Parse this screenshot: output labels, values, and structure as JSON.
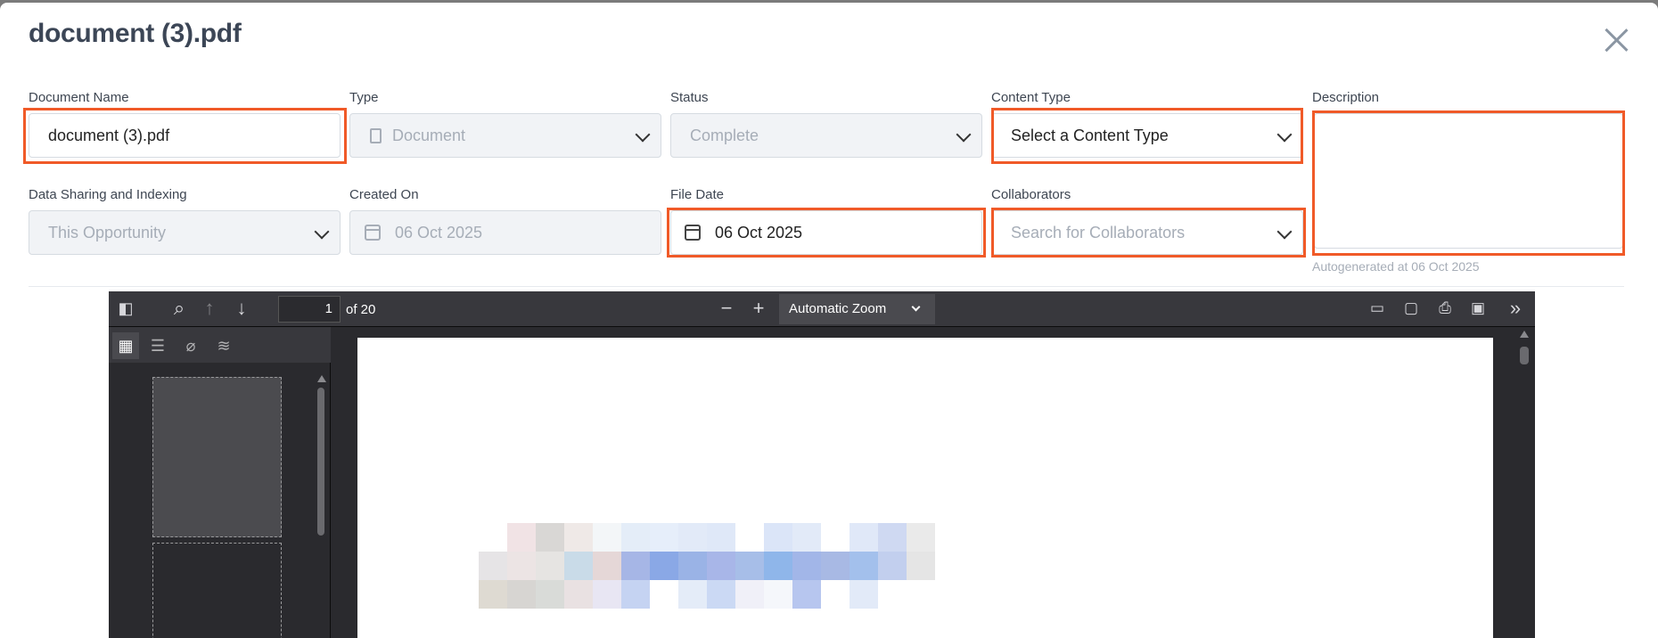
{
  "modal": {
    "title": "document (3).pdf"
  },
  "form": {
    "document_name": {
      "label": "Document Name",
      "value": "document (3).pdf"
    },
    "type": {
      "label": "Type",
      "value": "Document"
    },
    "status": {
      "label": "Status",
      "value": "Complete"
    },
    "content_type": {
      "label": "Content Type",
      "value": "Select a Content Type"
    },
    "description": {
      "label": "Description",
      "value": "",
      "hint": "Autogenerated at 06 Oct 2025"
    },
    "data_sharing": {
      "label": "Data Sharing and Indexing",
      "value": "This Opportunity"
    },
    "created_on": {
      "label": "Created On",
      "value": "06 Oct 2025"
    },
    "file_date": {
      "label": "File Date",
      "value": "06 Oct 2025"
    },
    "collaborators": {
      "label": "Collaborators",
      "placeholder": "Search for Collaborators"
    }
  },
  "viewer": {
    "current_page": "1",
    "page_count_text": "of 20",
    "zoom": "Automatic Zoom"
  },
  "colors": {
    "highlight": "#f05a28",
    "title": "#3c4656",
    "viewer_bg": "#2a2a2e"
  }
}
